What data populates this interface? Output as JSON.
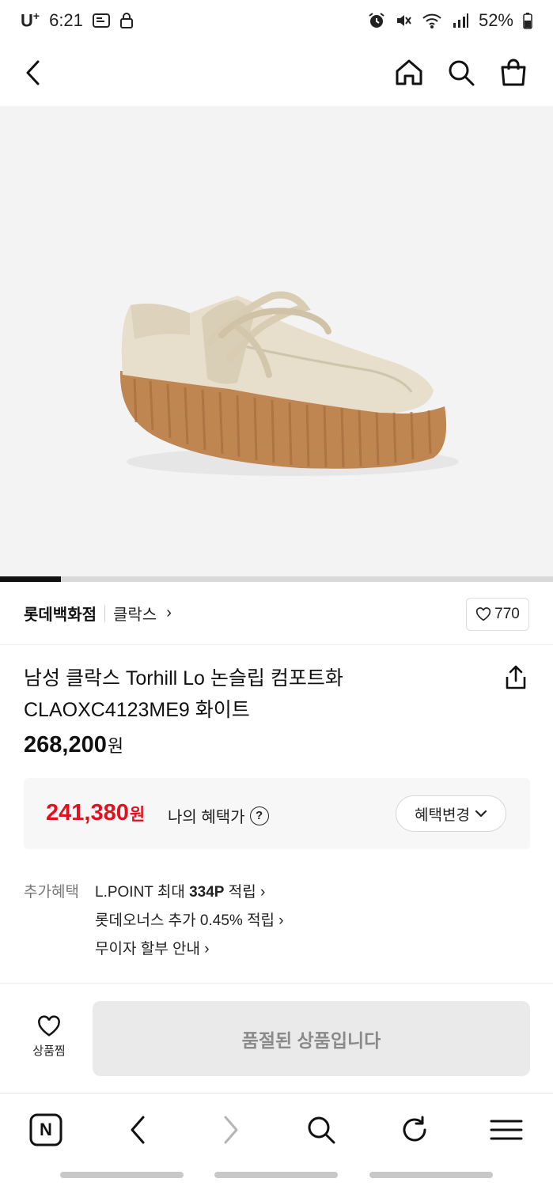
{
  "status_bar": {
    "carrier": "U",
    "carrier_sup": "+",
    "time": "6:21",
    "battery": "52%"
  },
  "app_bar": {
    "back_icon": "chevron-left-icon",
    "home_icon": "home-icon",
    "search_icon": "search-icon",
    "cart_icon": "shopping-bag-icon"
  },
  "gallery": {
    "progress_fraction": 0.11
  },
  "brand": {
    "store": "롯데백화점",
    "name": "클락스",
    "arrow": "›",
    "like_count": "770"
  },
  "product": {
    "title_line1": "남성 클락스 Torhill Lo 논슬립 컴포트화",
    "title_line2": "CLAOXC4123ME9 화이트",
    "price": "268,200",
    "currency": "원"
  },
  "benefit": {
    "price": "241,380",
    "currency": "원",
    "label": "나의 혜택가",
    "help": "?",
    "change_button": "혜택변경"
  },
  "extra_benefits": {
    "label": "추가혜택",
    "items": [
      {
        "prefix": "L.POINT 최대 ",
        "strong": "334P",
        "suffix": " 적립 ›"
      },
      {
        "prefix": "롯데오너스 추가 0.45% 적립 ›",
        "strong": "",
        "suffix": ""
      },
      {
        "prefix": "무이자 할부 안내 ›",
        "strong": "",
        "suffix": ""
      }
    ]
  },
  "purchase_bar": {
    "wish_label": "상품찜",
    "soldout_label": "품절된 상품입니다"
  },
  "browser_bar": {
    "naver_letter": "N"
  },
  "colors": {
    "accent_red": "#e0121f",
    "sole_brown": "#c08652",
    "upper_beige": "#e7dfcc"
  }
}
